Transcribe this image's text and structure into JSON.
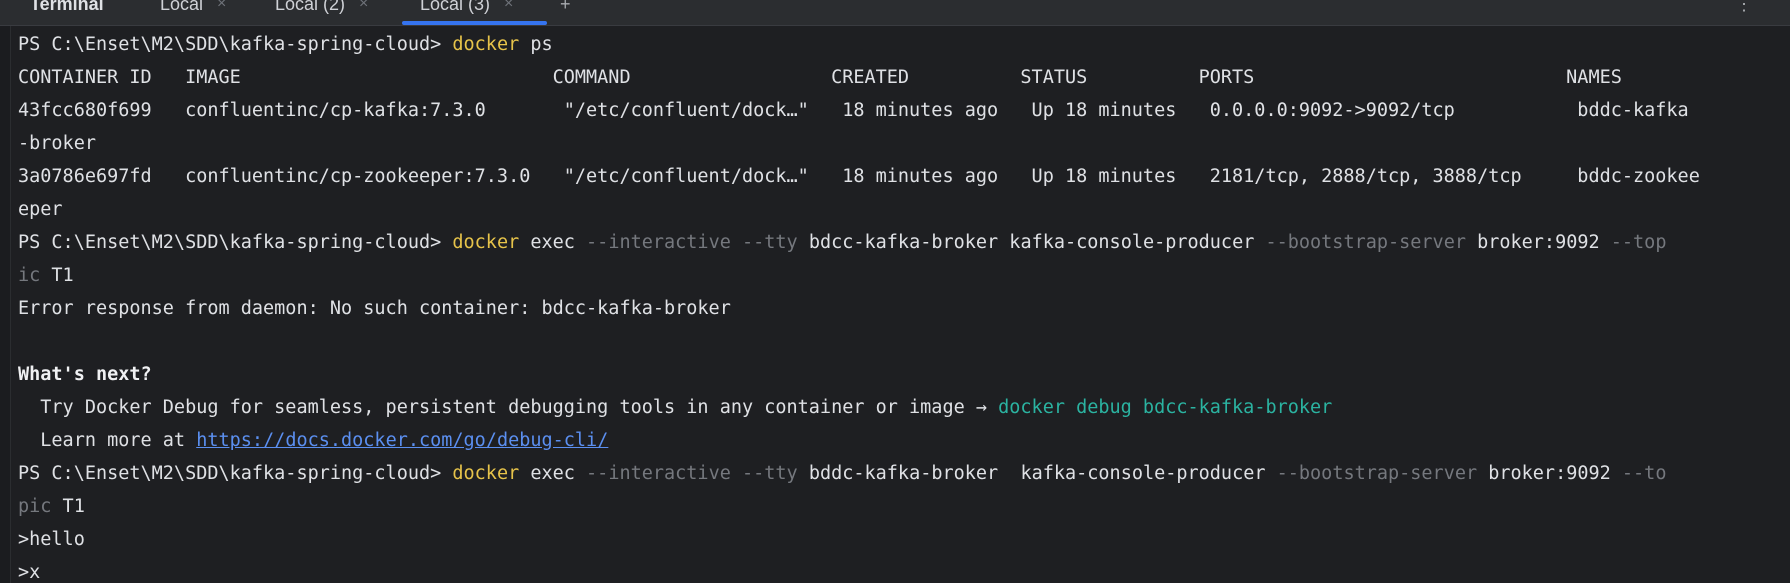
{
  "tabbar": {
    "title": "Terminal",
    "tabs": [
      {
        "label": "Local",
        "close": "×"
      },
      {
        "label": "Local (2)",
        "close": "×"
      },
      {
        "label": "Local (3)",
        "close": "×"
      }
    ],
    "add": "+",
    "more": "⋮"
  },
  "terminal": {
    "l01": {
      "prompt": "PS C:\\Enset\\M2\\SDD\\kafka-spring-cloud> ",
      "cmd": "docker",
      "rest": " ps"
    },
    "l02": "CONTAINER ID   IMAGE                            COMMAND                  CREATED          STATUS          PORTS                            NAMES",
    "l03": "43fcc680f699   confluentinc/cp-kafka:7.3.0       \"/etc/confluent/dock…\"   18 minutes ago   Up 18 minutes   0.0.0.0:9092->9092/tcp           bddc-kafka",
    "l04": "-broker",
    "l05": "3a0786e697fd   confluentinc/cp-zookeeper:7.3.0   \"/etc/confluent/dock…\"   18 minutes ago   Up 18 minutes   2181/tcp, 2888/tcp, 3888/tcp     bddc-zookee",
    "l06": "eper",
    "l07": {
      "prompt": "PS C:\\Enset\\M2\\SDD\\kafka-spring-cloud> ",
      "cmd": "docker",
      "exec": " exec ",
      "opt1": "--interactive",
      "sp1": " ",
      "opt2": "--tty",
      "args1": " bdcc-kafka-broker kafka-console-producer ",
      "opt3": "--bootstrap-server",
      "args2": " broker:9092 ",
      "opt4": "--top"
    },
    "l08": {
      "dim": "ic",
      "rest": " T1"
    },
    "l09": "Error response from daemon: No such container: bdcc-kafka-broker",
    "l10": "",
    "l11": "What's next?",
    "l12": {
      "text": "  Try Docker Debug for seamless, persistent debugging tools in any container or image → ",
      "cmd": "docker debug bdcc-kafka-broker"
    },
    "l13": {
      "text": "  Learn more at ",
      "link": "https://docs.docker.com/go/debug-cli/"
    },
    "l14": {
      "prompt": "PS C:\\Enset\\M2\\SDD\\kafka-spring-cloud> ",
      "cmd": "docker",
      "exec": " exec ",
      "opt1": "--interactive",
      "sp1": " ",
      "opt2": "--tty",
      "args1": " bddc-kafka-broker  kafka-console-producer ",
      "opt3": "--bootstrap-server",
      "args2": " broker:9092 ",
      "opt4": "--to"
    },
    "l15": {
      "dim": "pic",
      "rest": " T1"
    },
    "l16": ">hello",
    "l17": ">x"
  },
  "colors": {
    "background": "#1e1f22",
    "command": "#e6c34a",
    "option": "#75787e",
    "hint_command": "#2bb3a1",
    "link": "#5b8ff0",
    "tab_accent": "#3574f0"
  }
}
